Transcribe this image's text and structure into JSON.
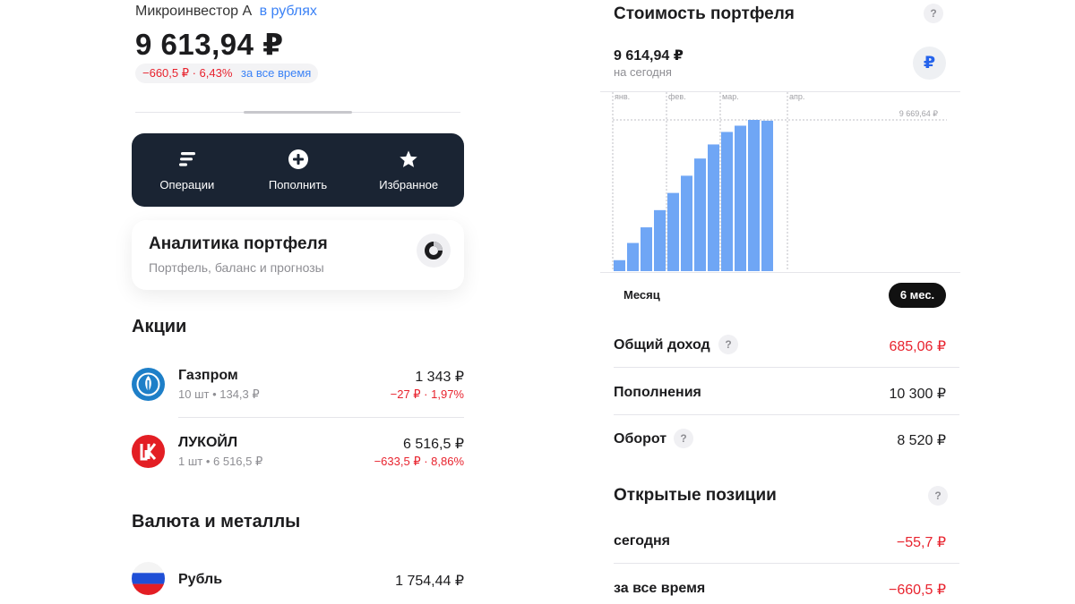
{
  "account": {
    "name": "Микроинвестор А",
    "currency_link": "в рублях",
    "total": "9 613,94 ₽",
    "change": "−660,5 ₽ · 6,43%",
    "change_period": "за все время"
  },
  "actions": [
    {
      "label": "Операции",
      "icon": "operations-icon"
    },
    {
      "label": "Пополнить",
      "icon": "plus-circle-icon"
    },
    {
      "label": "Избранное",
      "icon": "star-icon"
    }
  ],
  "analytics": {
    "title": "Аналитика портфеля",
    "subtitle": "Портфель, баланс и прогнозы",
    "icon": "donut-chart-icon"
  },
  "stocks": {
    "title": "Акции",
    "items": [
      {
        "name": "Газпром",
        "qty": "10 шт • 134,3 ₽",
        "value": "1 343 ₽",
        "change": "−27 ₽ · 1,97%",
        "logo_color": "#1e7fc8",
        "icon": "gazprom-logo"
      },
      {
        "name": "ЛУКОЙЛ",
        "qty": "1 шт • 6 516,5 ₽",
        "value": "6 516,5 ₽",
        "change": "−633,5 ₽ · 8,86%",
        "logo_color": "#e31e24",
        "icon": "lukoil-logo"
      }
    ]
  },
  "currencies": {
    "title": "Валюта и металлы",
    "items": [
      {
        "name": "Рубль",
        "value": "1 754,44 ₽",
        "icon": "russia-flag-icon"
      }
    ]
  },
  "portfolio_value": {
    "title": "Стоимость портфеля",
    "help": "?",
    "value": "9 614,94 ₽",
    "subtitle": "на сегодня",
    "currency_button": "₽"
  },
  "chart_data": {
    "type": "bar",
    "x_labels": [
      "янв.",
      "фев.",
      "мар.",
      "апр."
    ],
    "max_label": "9 669,64 ₽",
    "values": [
      700,
      1800,
      2800,
      3900,
      5000,
      6100,
      7200,
      8100,
      8900,
      9300,
      9669.64,
      9620
    ],
    "ylim": [
      0,
      9669.64
    ],
    "bar_color": "#6fa6f5",
    "grid": true
  },
  "periods": {
    "month": "Месяц",
    "six_months": "6 мес."
  },
  "stats": [
    {
      "label": "Общий доход",
      "value": "685,06 ₽",
      "red": true,
      "help": true
    },
    {
      "label": "Пополнения",
      "value": "10 300 ₽",
      "red": false,
      "help": false
    },
    {
      "label": "Оборот",
      "value": "8 520 ₽",
      "red": false,
      "help": true
    }
  ],
  "open_positions": {
    "title": "Открытые позиции",
    "help": "?",
    "rows": [
      {
        "label": "сегодня",
        "value": "−55,7 ₽"
      },
      {
        "label": "за все время",
        "value": "−660,5 ₽"
      }
    ]
  },
  "colors": {
    "accent": "#3b82f6",
    "negative": "#e8232e",
    "dark_panel": "#1a2433"
  }
}
